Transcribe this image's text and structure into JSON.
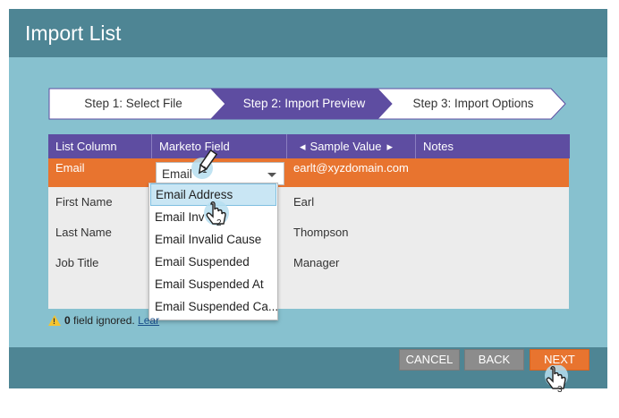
{
  "dialog": {
    "title": "Import List"
  },
  "wizard": {
    "steps": [
      {
        "label": "Step 1: Select File",
        "state": "done"
      },
      {
        "label": "Step 2: Import Preview",
        "state": "active"
      },
      {
        "label": "Step 3: Import Options",
        "state": "pending"
      }
    ]
  },
  "table": {
    "columns": [
      "List Column",
      "Marketo Field",
      "Sample Value",
      "Notes"
    ],
    "rows": [
      {
        "list_column": "Email",
        "marketo_field": "Email",
        "sample_value": "earlt@xyzdomain.com",
        "notes": ""
      },
      {
        "list_column": "First Name",
        "marketo_field": "",
        "sample_value": "Earl",
        "notes": ""
      },
      {
        "list_column": "Last Name",
        "marketo_field": "",
        "sample_value": "Thompson",
        "notes": ""
      },
      {
        "list_column": "Job Title",
        "marketo_field": "",
        "sample_value": "Manager",
        "notes": ""
      }
    ]
  },
  "dropdown": {
    "options": [
      "Email Address",
      "Email Inv",
      "Email Invalid Cause",
      "Email Suspended",
      "Email Suspended At",
      "Email Suspended Ca..."
    ],
    "highlighted_index": 0
  },
  "status": {
    "count": "0",
    "text": " field ignored. ",
    "link": "Lear"
  },
  "buttons": {
    "cancel": "CANCEL",
    "back": "BACK",
    "next": "NEXT"
  },
  "callouts": [
    "1",
    "2",
    "3"
  ],
  "colors": {
    "header_bar": "#4e8594",
    "body": "#87c1cf",
    "active_step": "#5e4da1",
    "selected_row": "#e8742f",
    "next_button": "#e8742f"
  }
}
